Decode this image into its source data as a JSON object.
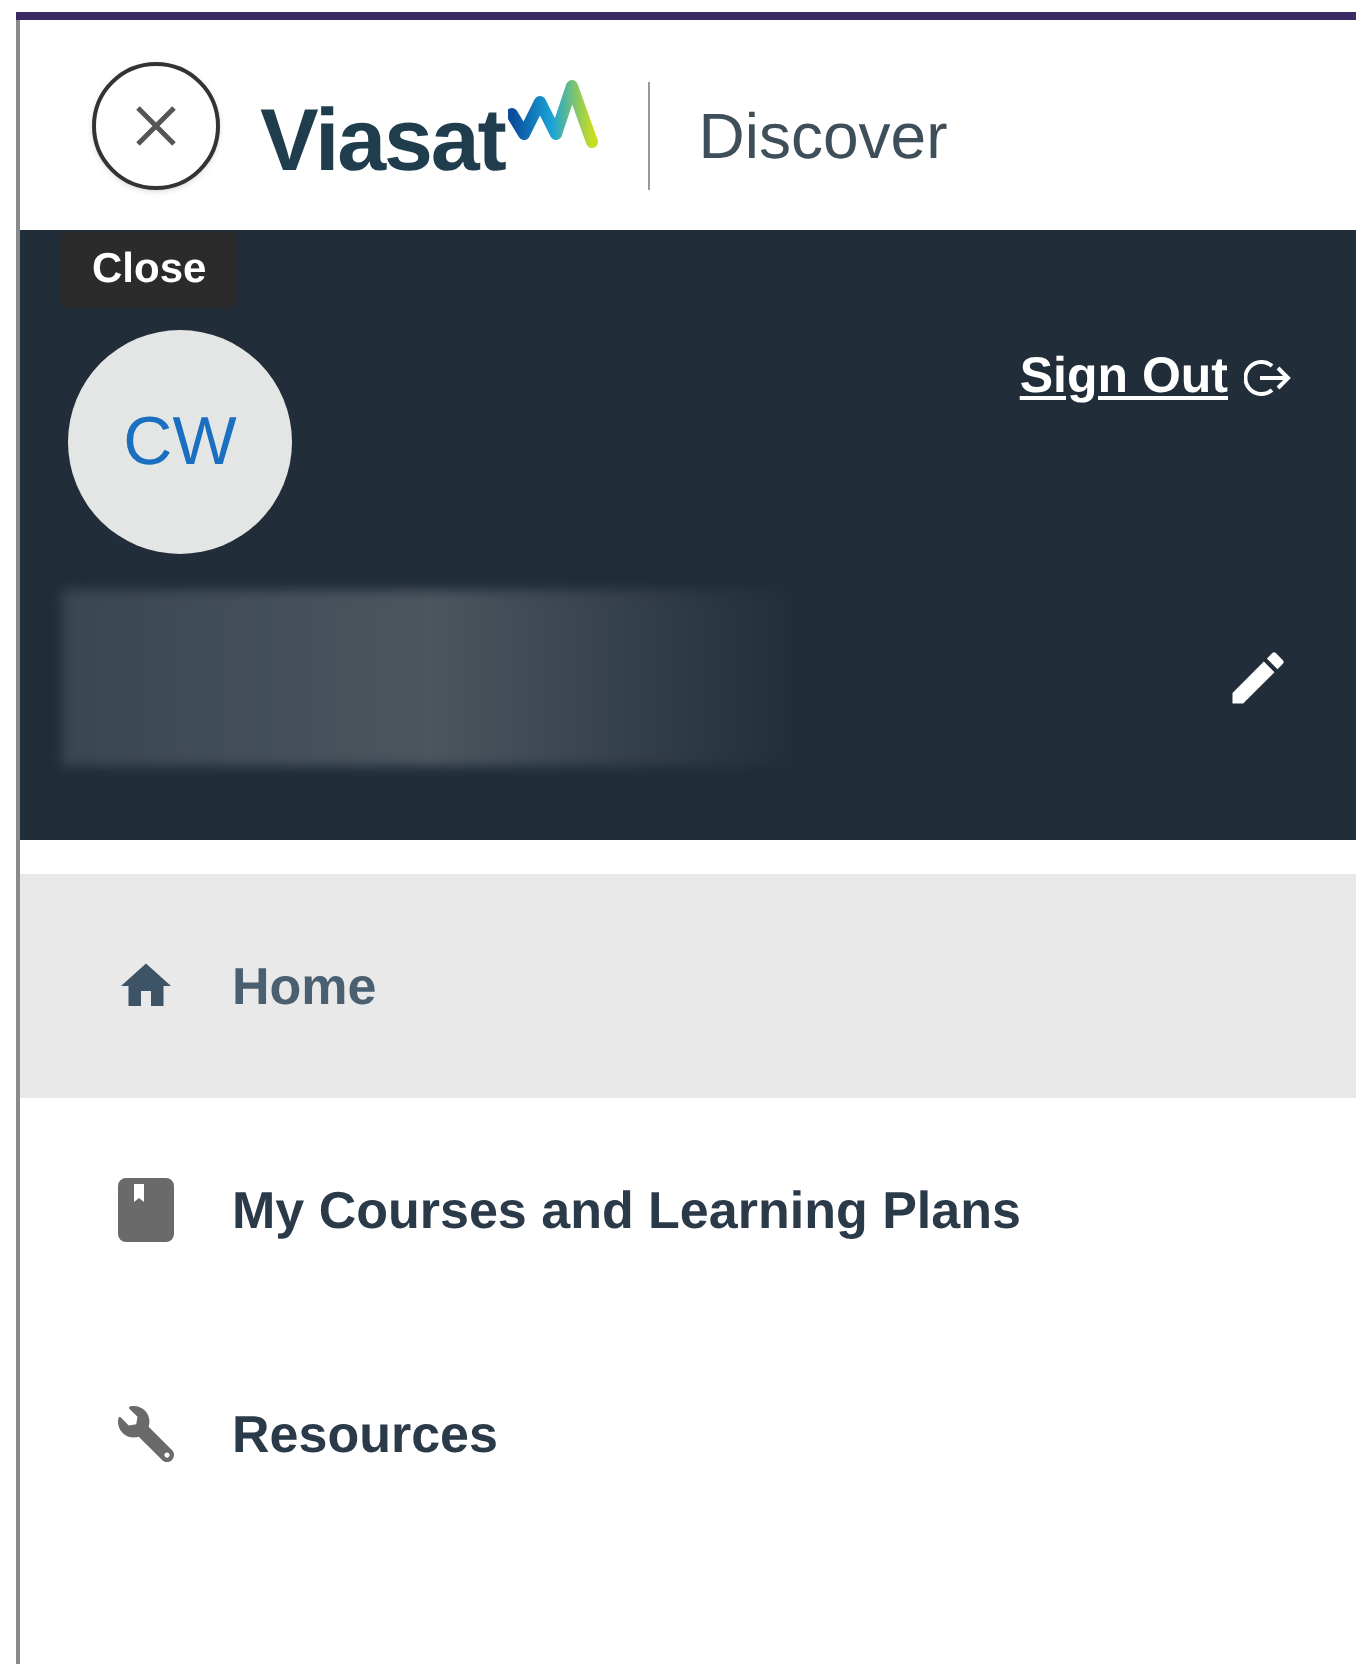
{
  "header": {
    "close_tooltip": "Close",
    "logo": "Viasat",
    "app_name": "Discover"
  },
  "profile": {
    "initials": "CW",
    "sign_out": "Sign Out"
  },
  "nav": [
    {
      "label": "Home",
      "kind": "home",
      "selected": true
    },
    {
      "label": "My Courses and Learning Plans",
      "kind": "book",
      "selected": false
    },
    {
      "label": "Resources",
      "kind": "wrench",
      "selected": false
    }
  ]
}
